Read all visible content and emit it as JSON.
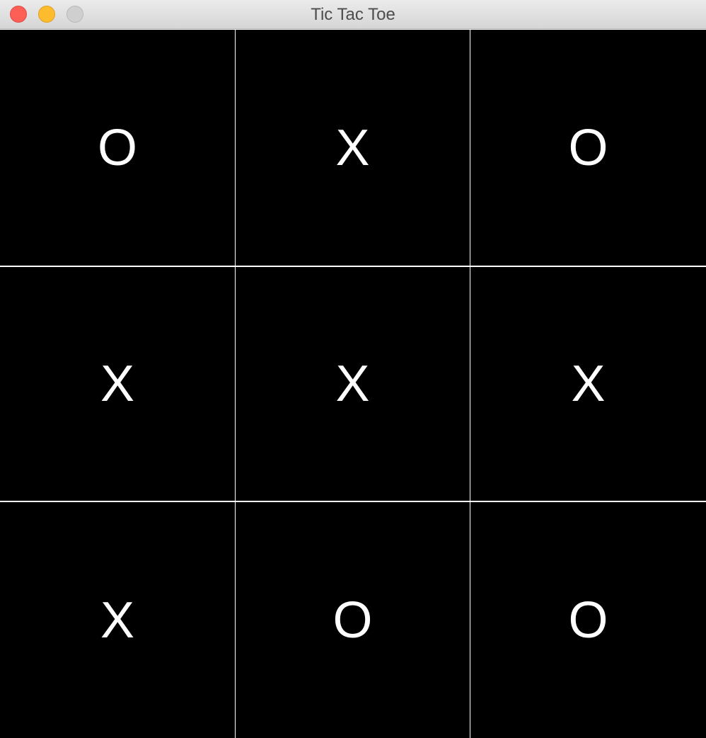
{
  "window": {
    "title": "Tic Tac Toe",
    "controls": {
      "close_color": "#fd5f57",
      "minimize_color": "#fdbb2e",
      "zoom_color": "#cfcfcf"
    }
  },
  "board": {
    "rows": [
      [
        "O",
        "X",
        "O"
      ],
      [
        "X",
        "X",
        "X"
      ],
      [
        "X",
        "O",
        "O"
      ]
    ],
    "cell_color": "#000000",
    "mark_color": "#ffffff",
    "grid_line_color": "#ffffff"
  }
}
